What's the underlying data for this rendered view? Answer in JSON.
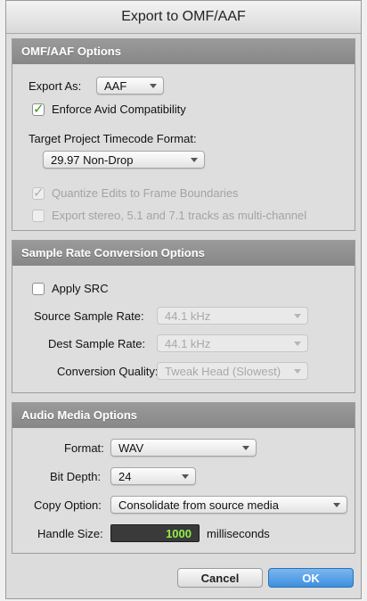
{
  "window": {
    "title": "Export to OMF/AAF"
  },
  "omf": {
    "header": "OMF/AAF Options",
    "export_as_label": "Export As:",
    "export_as_value": "AAF",
    "enforce_label": "Enforce Avid Compatibility",
    "enforce_checked": true,
    "timecode_label": "Target Project Timecode Format:",
    "timecode_value": "29.97 Non-Drop",
    "quantize_label": "Quantize Edits to Frame Boundaries",
    "quantize_checked": true,
    "multichannel_label": "Export stereo, 5.1 and 7.1 tracks as multi-channel",
    "multichannel_checked": false
  },
  "src": {
    "header": "Sample Rate Conversion Options",
    "apply_label": "Apply SRC",
    "apply_checked": false,
    "source_label": "Source Sample Rate:",
    "source_value": "44.1 kHz",
    "dest_label": "Dest Sample Rate:",
    "dest_value": "44.1 kHz",
    "quality_label": "Conversion Quality:",
    "quality_value": "Tweak Head (Slowest)"
  },
  "audio": {
    "header": "Audio Media Options",
    "format_label": "Format:",
    "format_value": "WAV",
    "bitdepth_label": "Bit Depth:",
    "bitdepth_value": "24",
    "copy_label": "Copy Option:",
    "copy_value": "Consolidate from source media",
    "handle_label": "Handle Size:",
    "handle_value": "1000",
    "handle_unit": "milliseconds"
  },
  "buttons": {
    "cancel": "Cancel",
    "ok": "OK"
  },
  "colors": {
    "ok_button": "#3f8fdf",
    "check_green": "#3a9a1a",
    "handle_text": "#8ff04a"
  },
  "icons": {
    "checkmark": "✓"
  }
}
